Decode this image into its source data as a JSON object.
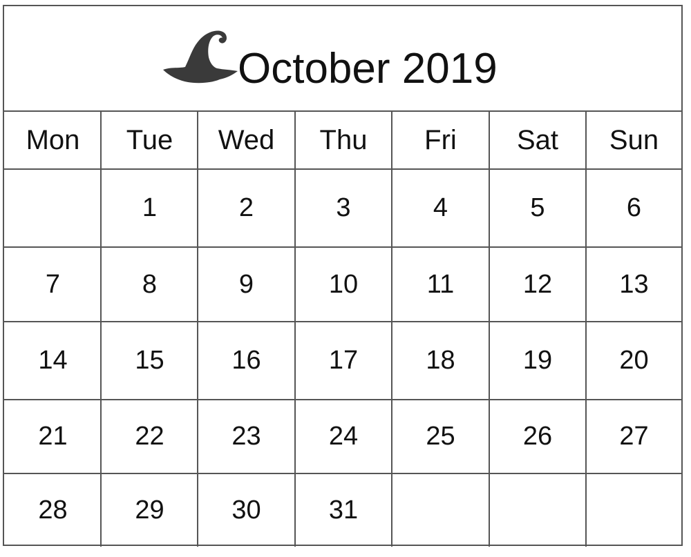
{
  "calendar": {
    "title": "October 2019",
    "icon": "witch-hat-icon",
    "weekdays": [
      "Mon",
      "Tue",
      "Wed",
      "Thu",
      "Fri",
      "Sat",
      "Sun"
    ],
    "weeks": [
      [
        "",
        "1",
        "2",
        "3",
        "4",
        "5",
        "6"
      ],
      [
        "7",
        "8",
        "9",
        "10",
        "11",
        "12",
        "13"
      ],
      [
        "14",
        "15",
        "16",
        "17",
        "18",
        "19",
        "20"
      ],
      [
        "21",
        "22",
        "23",
        "24",
        "25",
        "26",
        "27"
      ],
      [
        "28",
        "29",
        "30",
        "31",
        "",
        "",
        ""
      ]
    ]
  }
}
